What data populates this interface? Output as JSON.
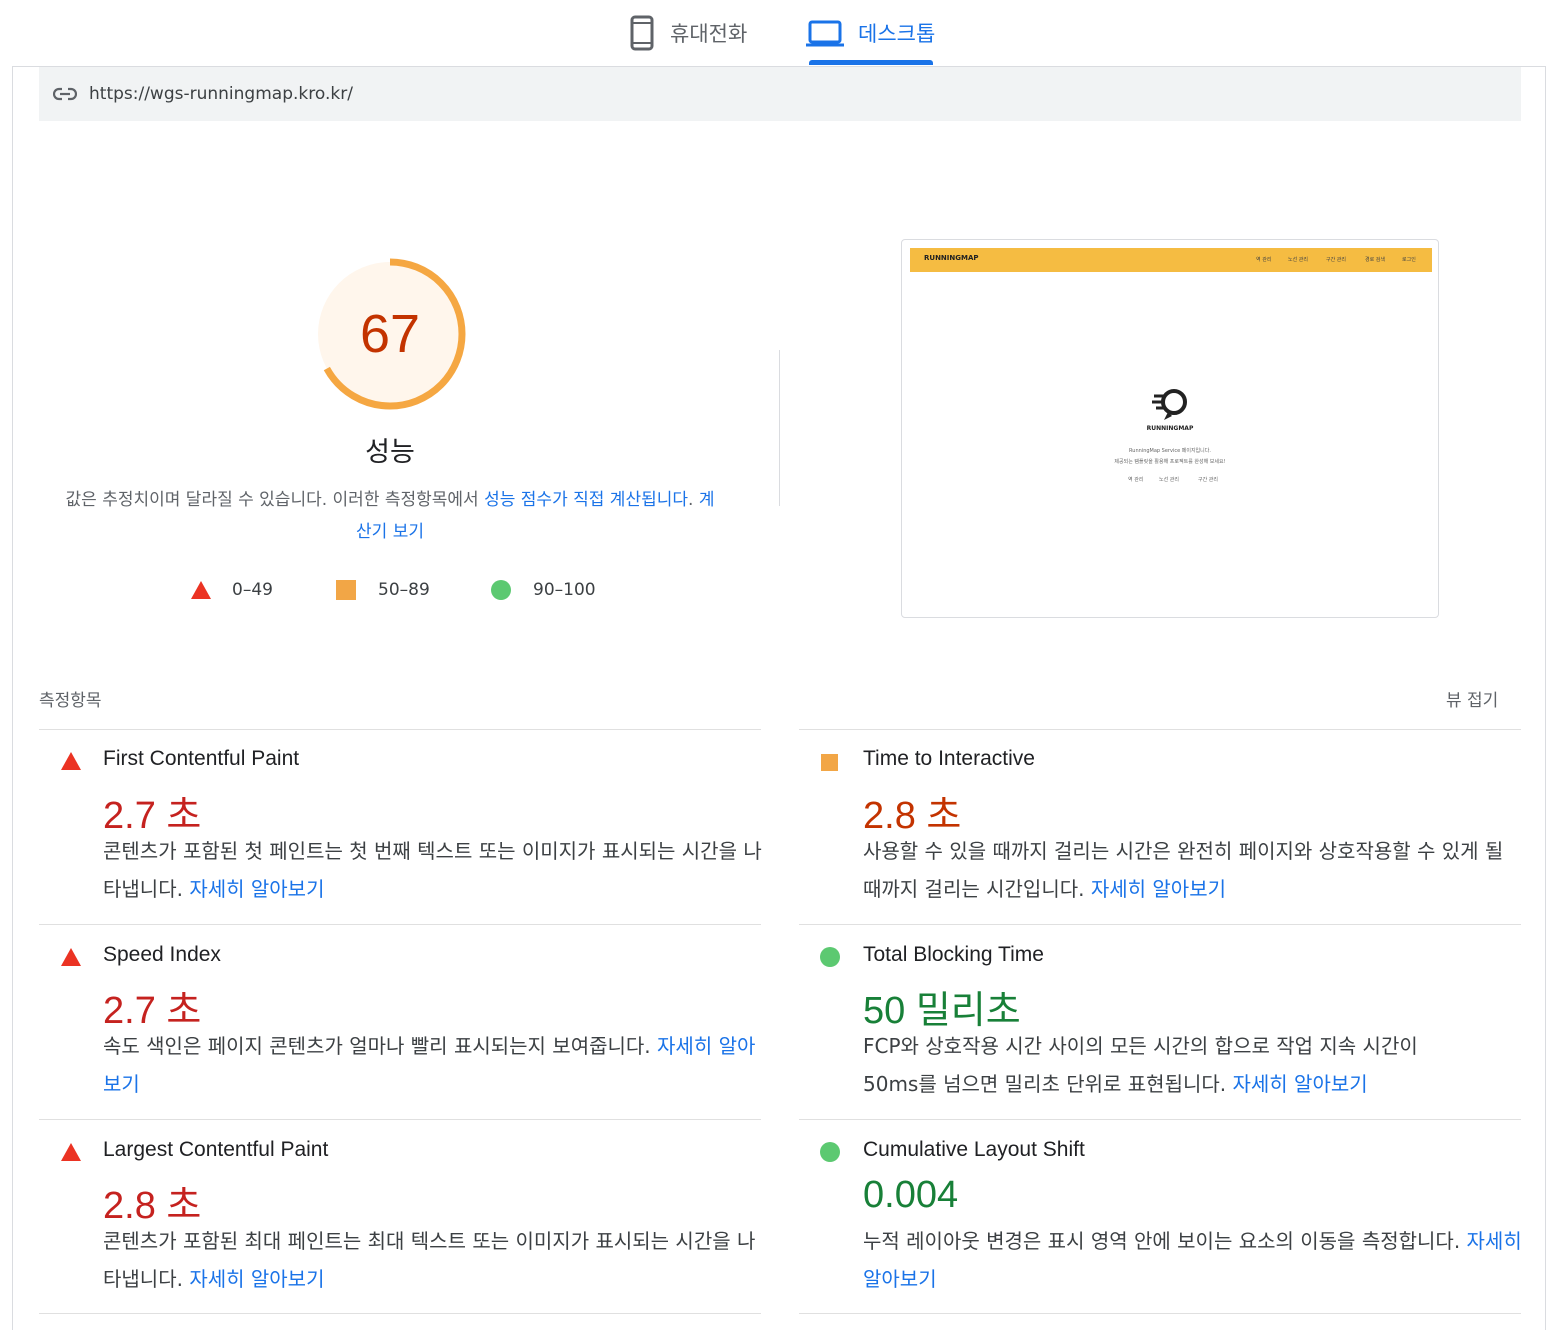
{
  "tabs": {
    "mobile_label": "휴대전화",
    "desktop_label": "데스크톱"
  },
  "url": "https://wgs-runningmap.kro.kr/",
  "performance": {
    "score": "67",
    "score_value": 67,
    "label": "성능",
    "desc_prefix": "값은 추정치이며 달라질 수 있습니다. 이러한 측정항목에서 ",
    "desc_link1": "성능 점수가 직접 계산됩니다",
    "desc_sep": ". ",
    "desc_link2": "계산기 보기"
  },
  "legend": {
    "fail": "0–49",
    "average": "50–89",
    "pass": "90–100"
  },
  "thumbnail": {
    "brand": "RUNNINGMAP",
    "nav": [
      "역 관리",
      "노선 관리",
      "구간 관리",
      "경로 검색",
      "로그인"
    ],
    "name": "RUNNINGMAP",
    "line1": "RunningMap Service 페이지입니다.",
    "line2": "제공되는 템플릿을 활용해 프로젝트를 완성해 보세요!",
    "links": [
      "역 관리",
      "노선 관리",
      "구간 관리"
    ]
  },
  "metrics_section": {
    "title": "측정항목",
    "toggle": "뷰 접기"
  },
  "learn_more": "자세히 알아보기",
  "metrics": [
    {
      "name": "First Contentful Paint",
      "value": "2.7 초",
      "status": "fail",
      "desc": "콘텐츠가 포함된 첫 페인트는 첫 번째 텍스트 또는 이미지가 표시되는 시간을 나타냅니다. "
    },
    {
      "name": "Time to Interactive",
      "value": "2.8 초",
      "status": "average",
      "desc": "사용할 수 있을 때까지 걸리는 시간은 완전히 페이지와 상호작용할 수 있게 될 때까지 걸리는 시간입니다. "
    },
    {
      "name": "Speed Index",
      "value": "2.7 초",
      "status": "fail",
      "desc": "속도 색인은 페이지 콘텐츠가 얼마나 빨리 표시되는지 보여줍니다. "
    },
    {
      "name": "Total Blocking Time",
      "value": "50 밀리초",
      "status": "pass",
      "desc": "FCP와 상호작용 시간 사이의 모든 시간의 합으로 작업 지속 시간이 50ms를 넘으면 밀리초 단위로 표현됩니다. "
    },
    {
      "name": "Largest Contentful Paint",
      "value": "2.8 초",
      "status": "fail",
      "desc": "콘텐츠가 포함된 최대 페인트는 최대 텍스트 또는 이미지가 표시되는 시간을 나타냅니다. "
    },
    {
      "name": "Cumulative Layout Shift",
      "value": "0.004",
      "status": "pass",
      "desc": "누적 레이아웃 변경은 표시 영역 안에 보이는 요소의 이동을 측정합니다. "
    }
  ],
  "colors": {
    "accent": "#1a73e8",
    "fail": "#eb3323",
    "average": "#f2a646",
    "pass": "#5cc971",
    "gauge_fill": "#f5a742",
    "gauge_bg": "#fff6ec"
  }
}
